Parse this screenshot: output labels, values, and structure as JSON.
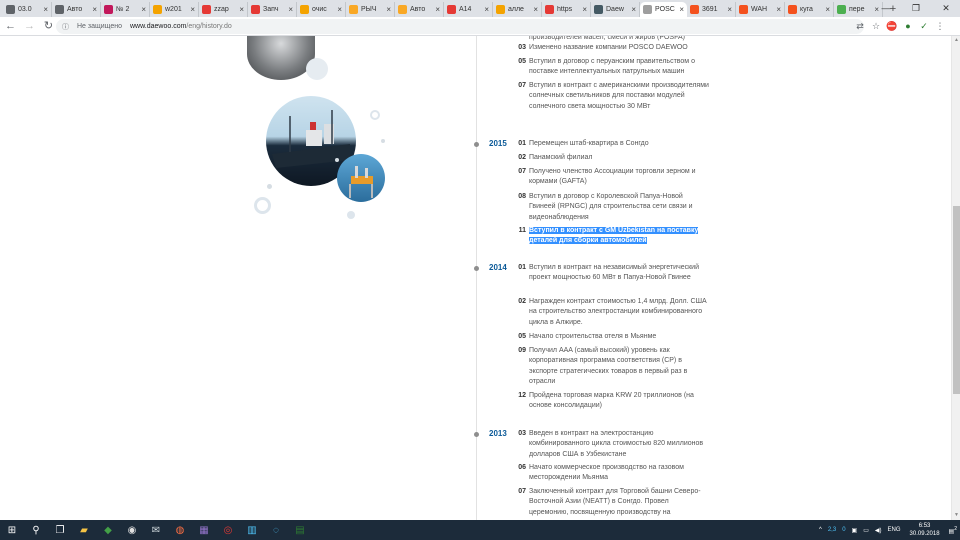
{
  "browser": {
    "tabs": [
      {
        "label": "03.0",
        "icon": "globe-icon",
        "color": "#5f6368"
      },
      {
        "label": "Авто",
        "icon": "globe-icon",
        "color": "#5f6368"
      },
      {
        "label": "№ 2",
        "icon": "d-icon",
        "color": "#c2185b"
      },
      {
        "label": "w201",
        "icon": "car-icon",
        "color": "#f4a300"
      },
      {
        "label": "zzap",
        "icon": "history-icon",
        "color": "#e53935"
      },
      {
        "label": "Запч",
        "icon": "zz-icon",
        "color": "#e53935"
      },
      {
        "label": "очис",
        "icon": "car-icon",
        "color": "#f4a300"
      },
      {
        "label": "РЫЧ",
        "icon": "lightning-icon",
        "color": "#f9a825"
      },
      {
        "label": "Авто",
        "icon": "lightning-icon",
        "color": "#f9a825"
      },
      {
        "label": "А14",
        "icon": "a-icon",
        "color": "#e53935"
      },
      {
        "label": "алле",
        "icon": "car-icon",
        "color": "#f4a300"
      },
      {
        "label": "https",
        "icon": "a-icon",
        "color": "#e53935"
      },
      {
        "label": "Daew",
        "icon": "v-icon",
        "color": "#455a64"
      },
      {
        "label": "POSC",
        "icon": "page-icon",
        "color": "#9e9e9e",
        "active": true
      },
      {
        "label": "3691",
        "icon": "fire-icon",
        "color": "#f4511e"
      },
      {
        "label": "WAH",
        "icon": "fire-icon",
        "color": "#f4511e"
      },
      {
        "label": "куга",
        "icon": "fire-icon",
        "color": "#f4511e"
      },
      {
        "label": "пере",
        "icon": "chrome-icon",
        "color": "#4caf50"
      }
    ],
    "new_tab": "+",
    "win_min": "—",
    "win_max": "❐",
    "win_close": "✕",
    "security": "Не защищено",
    "url_domain": "www.daewoo.com",
    "url_path": "/eng/history.do"
  },
  "timeline": {
    "top_events": [
      {
        "month": "",
        "text": "производителей масел, смеси и жиров (POSFA)"
      },
      {
        "month": "03",
        "text": "Изменено название компании POSCO DAEWOO"
      },
      {
        "month": "05",
        "text": "Вступил в договор с перуанским правительством о поставке интеллектуальных патрульных машин"
      },
      {
        "month": "07",
        "text": "Вступил в контракт с американскими производителями солнечных светильников для поставки модулей солнечного света мощностью 30 МВт"
      }
    ],
    "years": [
      {
        "year": "2015",
        "events": [
          {
            "month": "01",
            "text": "Перемещен штаб-квартира в Сонгдо"
          },
          {
            "month": "02",
            "text": "Панамский филиал"
          },
          {
            "month": "07",
            "text": "Получено членство Ассоциации торговли зерном и кормами (GAFTA)"
          },
          {
            "month": "08",
            "text": "Вступил в договор с Королевской Папуа-Новой Гвинеей (RPNGC) для строительства сети связи и видеонаблюдения"
          },
          {
            "month": "11",
            "text": "Вступил в контракт с GM Uzbekistan на поставку деталей для сборки автомобилей",
            "highlight": true
          }
        ]
      },
      {
        "year": "2014",
        "events": [
          {
            "month": "01",
            "text": "Вступил в контракт на независимый энергетический проект мощностью 60 МВт в Папуа-Новой Гвинее"
          },
          {
            "month": "02",
            "text": "Награжден контракт стоимостью 1,4 млрд. Долл. США на строительство электростанции комбинированного цикла в Алжире."
          },
          {
            "month": "05",
            "text": "Начало строительства отеля в Мьянме"
          },
          {
            "month": "09",
            "text": "Получил AAA (самый высокий) уровень как корпоративная программа соответствия (CP) в экспорте стратегических товаров в первый раз в отрасли"
          },
          {
            "month": "12",
            "text": "Пройдена торговая марка KRW 20 триллионов (на основе консолидации)"
          }
        ]
      },
      {
        "year": "2013",
        "events": [
          {
            "month": "03",
            "text": "Введен в контракт на электростанцию комбинированного цикла стоимостью 820 миллионов долларов США в Узбекистане"
          },
          {
            "month": "06",
            "text": "Начато коммерческое производство на газовом месторождении Мьянма"
          },
          {
            "month": "07",
            "text": "Заключенный контракт для Торговой башни Северо-Восточной Азии (NEATT) в Сонгдо. Провел церемонию, посвященную производству на"
          }
        ]
      }
    ]
  },
  "taskbar": {
    "start": "⊞",
    "search": "⚲",
    "task_view": "❐",
    "apps": [
      "explorer-icon",
      "media-icon",
      "chrome-icon",
      "mail-icon",
      "firefox-icon",
      "archive-icon",
      "opera-icon",
      "files-icon",
      "globe-icon",
      "excel-icon"
    ],
    "tray_arrow": "^",
    "tray_num1": "2,3",
    "tray_num2": "0",
    "lang": "ENG",
    "time": "6:53",
    "date": "30.09.2018",
    "notif_count": "2"
  }
}
